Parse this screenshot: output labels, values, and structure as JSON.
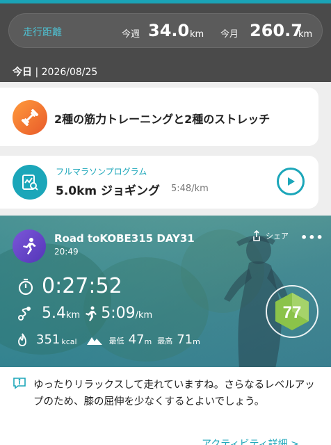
{
  "summary": {
    "label": "走行距離",
    "week_label": "今週",
    "week_value": "34.0",
    "week_unit": "km",
    "month_label": "今月",
    "month_value": "260.7",
    "month_unit": "km"
  },
  "date": {
    "today": "今日",
    "separator": " | ",
    "value": "2026/08/25"
  },
  "training_card": {
    "icon": "dumbbell-icon",
    "text": "2種の筋力トレーニングと2種のストレッチ"
  },
  "plan_card": {
    "icon": "plan-chart-icon",
    "program": "フルマラソンプログラム",
    "title": "5.0km ジョギング",
    "pace": "5:48/km"
  },
  "activity": {
    "title": "Road toKOBE315 DAY31",
    "time": "20:49",
    "share_label": "シェア",
    "duration": "0:27:52",
    "distance": "5.4",
    "distance_unit": "km",
    "pace": "5:09",
    "pace_unit": "/km",
    "calories": "351",
    "calories_unit": "kcal",
    "min_label": "最低",
    "min_value": "47",
    "min_unit": "m",
    "max_label": "最高",
    "max_value": "71",
    "max_unit": "m",
    "score": "77"
  },
  "advice": {
    "text": "ゆったりリラックスして走れていますね。さらなるレベルアップのため、膝の屈伸を少なくするとよいでしょう。",
    "link": "アクティビティ詳細 >"
  },
  "colors": {
    "accent": "#1ba6b9",
    "topbar": "#4a4a4a",
    "score_green": "#8bc34a",
    "run_purple": "#6a48cc"
  }
}
